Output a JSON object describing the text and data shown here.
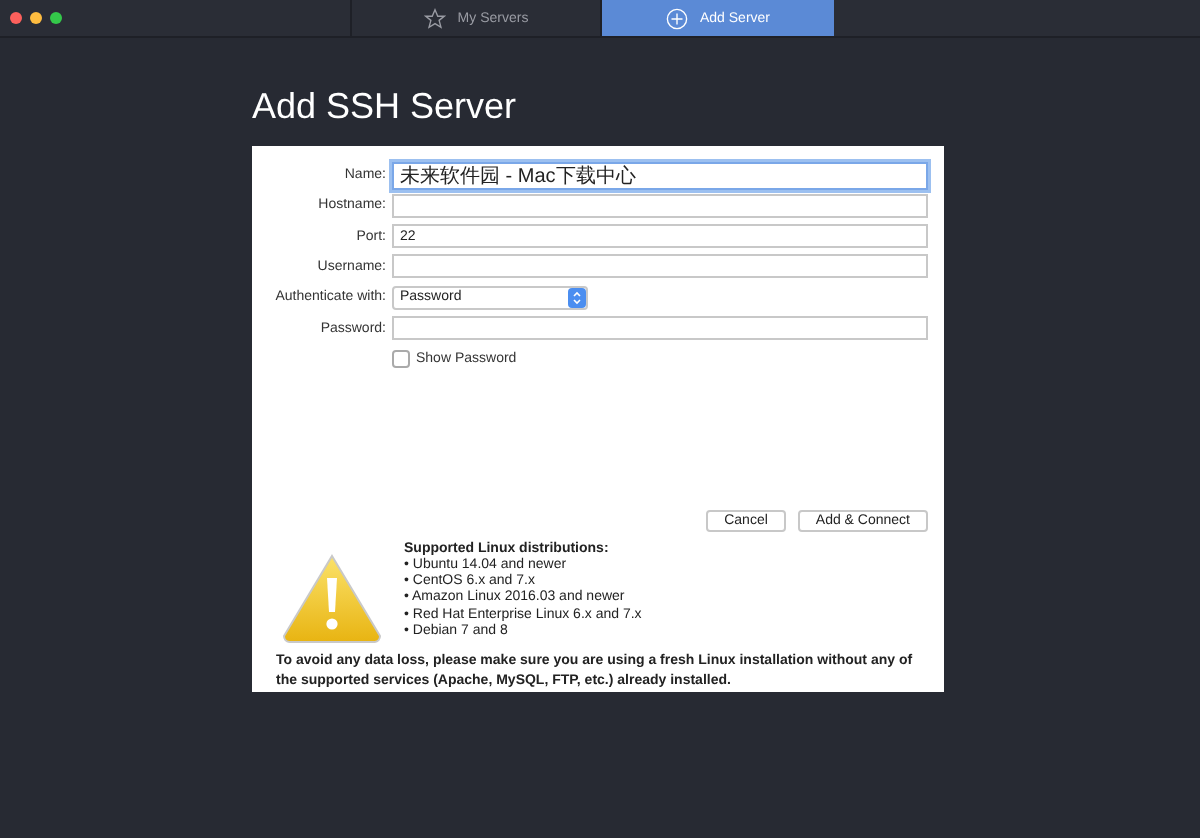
{
  "tabs": [
    {
      "label": "My Servers",
      "selected": false
    },
    {
      "label": "Add Server",
      "selected": true
    }
  ],
  "title": "Add SSH Server",
  "fields": [
    {
      "kind": "text",
      "label": "Name:",
      "value": "未来软件园 - Mac下载中心",
      "focused": true
    },
    {
      "kind": "text",
      "label": "Hostname:",
      "focused": false
    },
    {
      "kind": "text",
      "label": "Port:",
      "value": "22",
      "focused": false
    },
    {
      "kind": "text",
      "label": "Username:",
      "focused": false
    },
    {
      "kind": "select",
      "label": "Authenticate with:",
      "value": "Password",
      "focused": false
    },
    {
      "kind": "text",
      "label": "Password:",
      "focused": false
    },
    {
      "kind": "checkbox",
      "label": "Show Password",
      "checked": false
    }
  ],
  "buttons": [
    "Cancel",
    "Add & Connect"
  ],
  "notice": {
    "heading": "Supported Linux distributions:",
    "items": [
      "• Ubuntu 14.04 and newer",
      "• CentOS 6.x and 7.x",
      "• Amazon Linux 2016.03 and newer",
      "• Red Hat Enterprise Linux 6.x and 7.x",
      "• Debian 7 and 8"
    ],
    "warning": "To avoid any data loss, please make sure you are using a fresh Linux installation without any of the supported services (Apache, MySQL, FTP, etc.) already installed."
  }
}
